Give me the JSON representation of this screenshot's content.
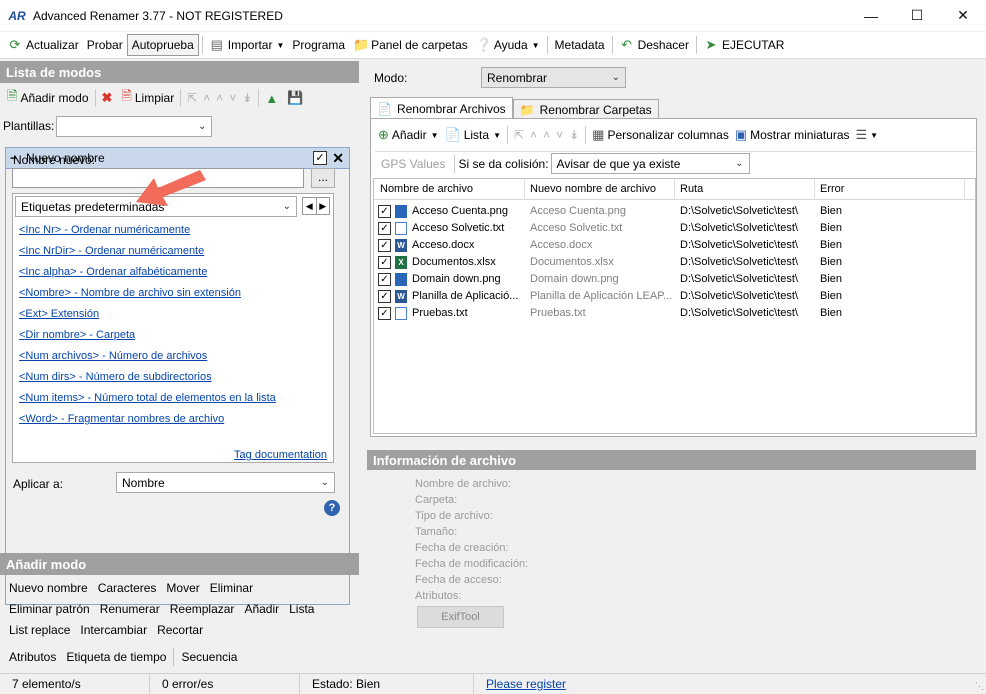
{
  "window": {
    "title": "Advanced Renamer 3.77 - NOT REGISTERED",
    "app_icon": "AR"
  },
  "menu": {
    "actualizar": "Actualizar",
    "probar": "Probar",
    "autoprueba": "Autoprueba",
    "importar": "Importar",
    "programa": "Programa",
    "panel_carpetas": "Panel de carpetas",
    "ayuda": "Ayuda",
    "metadata": "Metadata",
    "deshacer": "Deshacer",
    "ejecutar": "EJECUTAR"
  },
  "left": {
    "header": "Lista de modos",
    "anadir_modo": "Añadir modo",
    "limpiar": "Limpiar",
    "plantillas_label": "Plantillas:",
    "plantillas_value": "",
    "mode": {
      "title": "Nuevo nombre",
      "enabled": true,
      "nombre_nuevo_label": "Nombre nuevo:",
      "nombre_nuevo_value": "",
      "dots_label": "...",
      "tags_combo": "Etiquetas predeterminadas",
      "tags": [
        "<Inc Nr> - Ordenar numéricamente",
        "<Inc NrDir> - Ordenar numéricamente",
        "<Inc alpha> - Ordenar alfabéticamente",
        "<Nombre> - Nombre de archivo sin extensión",
        "<Ext> Extensión",
        "<Dir nombre> - Carpeta",
        "<Num archivos> - Número de archivos",
        "<Num dirs> - Número de subdirectorios",
        "<Num items> - Número total de elementos en la lista",
        "<Word> - Fragmentar nombres de archivo"
      ],
      "tag_doc": "Tag documentation",
      "aplicar_label": "Aplicar a:",
      "aplicar_value": "Nombre",
      "help_glyph": "?"
    },
    "add_header": "Añadir modo",
    "add_rows": [
      [
        "Nuevo nombre",
        "Caracteres",
        "Mover",
        "Eliminar"
      ],
      [
        "Eliminar patrón",
        "Renumerar",
        "Reemplazar",
        "Añadir",
        "Lista"
      ],
      [
        "List replace",
        "Intercambiar",
        "Recortar"
      ],
      [
        "Atributos",
        "Etiqueta de tiempo",
        "Secuencia"
      ]
    ]
  },
  "right": {
    "modo_label": "Modo:",
    "modo_value": "Renombrar",
    "tabs": [
      "Renombrar Archivos",
      "Renombrar Carpetas"
    ],
    "anadir": "Añadir",
    "lista": "Lista",
    "personalizar": "Personalizar columnas",
    "miniaturas": "Mostrar miniaturas",
    "gps": "GPS Values",
    "colision_label": "Si se da colisión:",
    "colision_value": "Avisar de que ya existe",
    "columns": [
      "Nombre de archivo",
      "Nuevo nombre de archivo",
      "Ruta",
      "Error"
    ],
    "files": [
      {
        "name": "Acceso Cuenta.png",
        "new": "Acceso Cuenta.png",
        "path": "D:\\Solvetic\\Solvetic\\test\\",
        "error": "Bien",
        "type": "png",
        "badge": ""
      },
      {
        "name": "Acceso Solvetic.txt",
        "new": "Acceso Solvetic.txt",
        "path": "D:\\Solvetic\\Solvetic\\test\\",
        "error": "Bien",
        "type": "txt",
        "badge": ""
      },
      {
        "name": "Acceso.docx",
        "new": "Acceso.docx",
        "path": "D:\\Solvetic\\Solvetic\\test\\",
        "error": "Bien",
        "type": "docx",
        "badge": "W"
      },
      {
        "name": "Documentos.xlsx",
        "new": "Documentos.xlsx",
        "path": "D:\\Solvetic\\Solvetic\\test\\",
        "error": "Bien",
        "type": "xlsx",
        "badge": "X"
      },
      {
        "name": "Domain down.png",
        "new": "Domain down.png",
        "path": "D:\\Solvetic\\Solvetic\\test\\",
        "error": "Bien",
        "type": "png",
        "badge": ""
      },
      {
        "name": "Planilla de Aplicació...",
        "new": "Planilla de Aplicación LEAP...",
        "path": "D:\\Solvetic\\Solvetic\\test\\",
        "error": "Bien",
        "type": "docx",
        "badge": "W"
      },
      {
        "name": "Pruebas.txt",
        "new": "Pruebas.txt",
        "path": "D:\\Solvetic\\Solvetic\\test\\",
        "error": "Bien",
        "type": "txt",
        "badge": ""
      }
    ],
    "info_header": "Información de archivo",
    "info_labels": [
      "Nombre de archivo:",
      "Carpeta:",
      "Tipo de archivo:",
      "Tamaño:",
      "Fecha de creación:",
      "Fecha de modificación:",
      "Fecha de acceso:",
      "Atributos:"
    ],
    "exiftool": "ExifTool"
  },
  "status": {
    "count": "7 elemento/s",
    "errors": "0 error/es",
    "estado": "Estado: Bien",
    "register": "Please register"
  },
  "colors": {
    "panel_header": "#a0a0a0",
    "mode_header": "#c9d8ea",
    "link": "#0645ad",
    "arrow": "#f36b5a"
  }
}
